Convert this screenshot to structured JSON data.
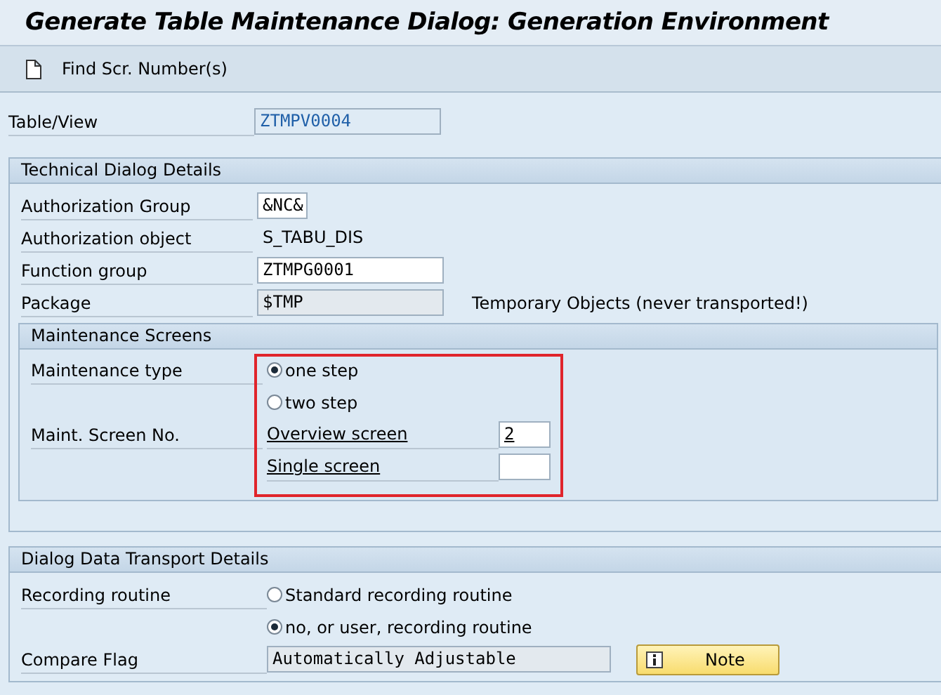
{
  "title": "Generate Table Maintenance Dialog: Generation Environment",
  "toolbar": [
    {
      "label": "Find Scr. Number(s)"
    }
  ],
  "table_view": {
    "label": "Table/View",
    "value": "ZTMPV0004"
  },
  "technical": {
    "title": "Technical Dialog Details",
    "fields": [
      {
        "label": "Authorization Group",
        "value": "&NC&",
        "kind": "input"
      },
      {
        "label": "Authorization object",
        "value": "S_TABU_DIS",
        "kind": "text"
      },
      {
        "label": "Function group",
        "value": "ZTMPG0001",
        "kind": "input"
      },
      {
        "label": "Package",
        "value": "$TMP",
        "kind": "readonly",
        "note": "Temporary Objects (never transported!)"
      }
    ],
    "maintenance": {
      "title": "Maintenance Screens",
      "type_label": "Maintenance type",
      "options": [
        {
          "label": "one step",
          "selected": true
        },
        {
          "label": "two step",
          "selected": false
        }
      ],
      "screen_label": "Maint. Screen No.",
      "screens": [
        {
          "label": "Overview screen",
          "value": "2"
        },
        {
          "label": "Single screen"
        }
      ]
    }
  },
  "transport": {
    "title": "Dialog Data Transport Details",
    "recording_label": "Recording routine",
    "options": [
      {
        "label": "Standard recording routine",
        "selected": false
      },
      {
        "label": "no, or user, recording routine",
        "selected": true
      }
    ],
    "compare_label": "Compare Flag",
    "compare_value": "Automatically Adjustable",
    "note_button": "Note"
  }
}
